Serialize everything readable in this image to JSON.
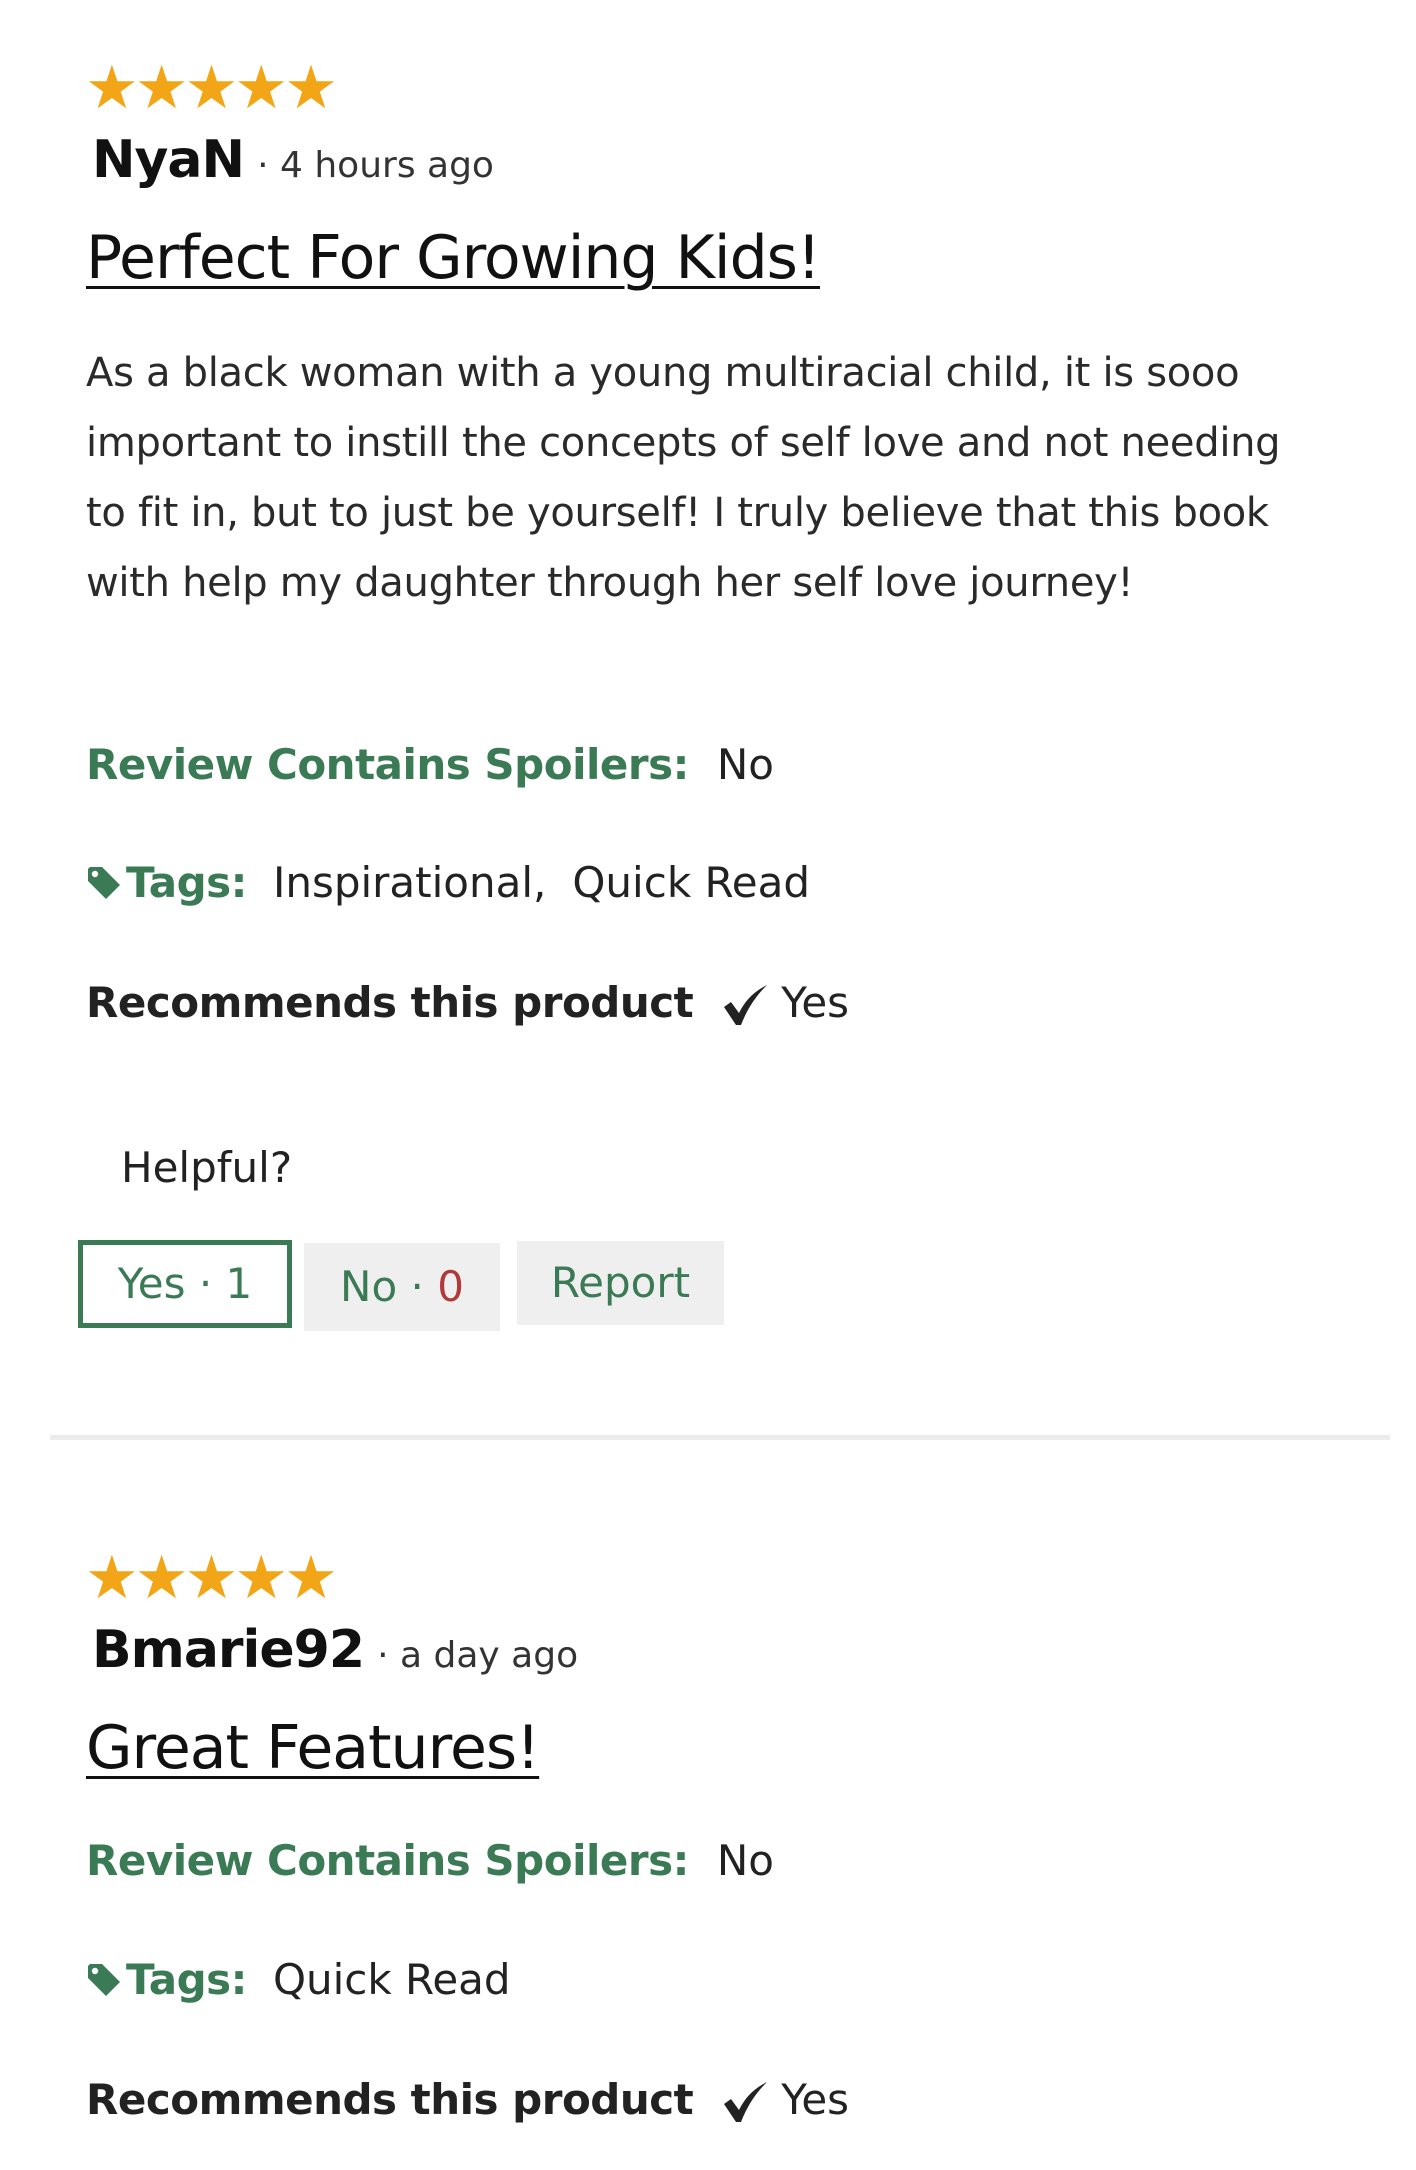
{
  "reviews": [
    {
      "stars": "★★★★★",
      "rating": 5,
      "author": "NyaN",
      "time": "· 4 hours ago",
      "title": "Perfect For Growing Kids!",
      "body": "As a black woman with a young multiracial child, it is sooo important to instill the concepts of self love and not needing to fit in, but to just be yourself! I truly believe that this book with help my daughter through her self love journey!",
      "spoilers_label": "Review Contains Spoilers:",
      "spoilers_value": "No",
      "tags_label": "Tags:",
      "tags": [
        "Inspirational,",
        "Quick Read"
      ],
      "recommends_label": "Recommends this product",
      "recommends_value": "Yes",
      "helpful_label": "Helpful?",
      "yes_label": "Yes · 1",
      "no_label": "No · ",
      "no_count": "0",
      "report_label": "Report"
    },
    {
      "stars": "★★★★★",
      "rating": 5,
      "author": "Bmarie92",
      "time": "· a day ago",
      "title": "Great Features!",
      "spoilers_label": "Review Contains Spoilers:",
      "spoilers_value": "No",
      "tags_label": "Tags:",
      "tags": [
        "Quick Read"
      ],
      "recommends_label": "Recommends this product",
      "recommends_value": "Yes"
    }
  ],
  "icons": {
    "star": "star-icon",
    "tag": "tag-icon",
    "check": "checkmark-icon"
  },
  "colors": {
    "star": "#f2a516",
    "accent_green": "#3a7a55",
    "no_count_red": "#b03a3a",
    "button_bg": "#efefef",
    "divider": "#ececec"
  }
}
